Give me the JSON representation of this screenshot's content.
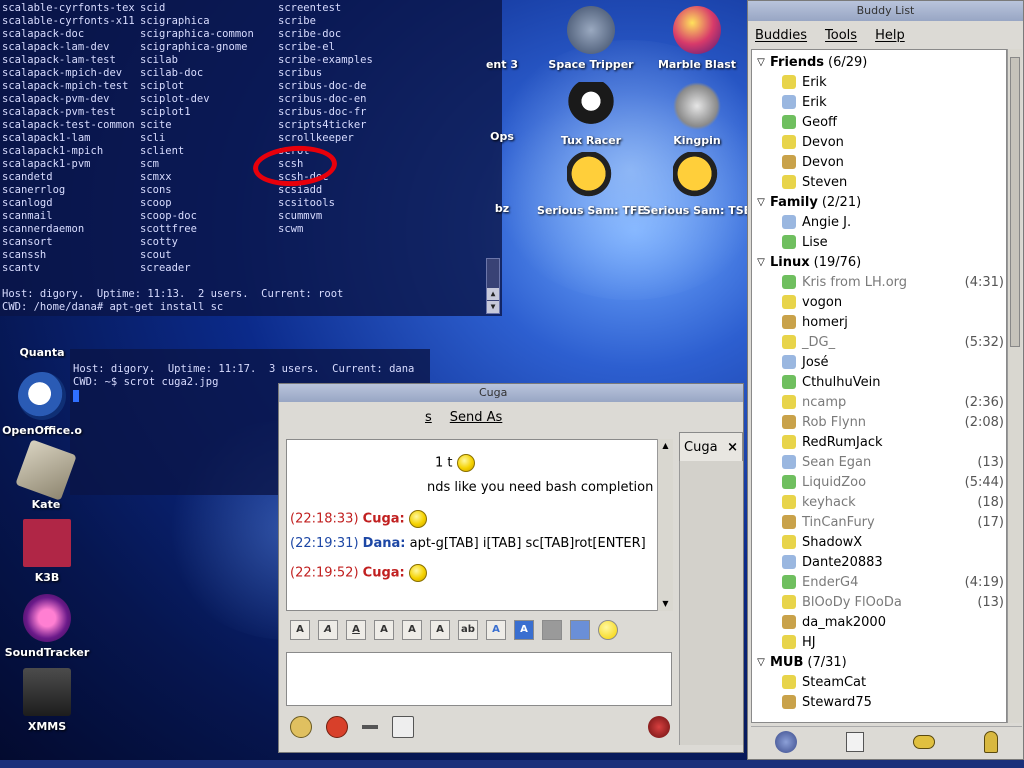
{
  "desktop_icons": [
    {
      "name": "quanta",
      "label": "Quanta"
    },
    {
      "name": "openoffice",
      "label": "OpenOffice.o"
    },
    {
      "name": "kate",
      "label": "Kate"
    },
    {
      "name": "k3b",
      "label": "K3B"
    },
    {
      "name": "soundtracker",
      "label": "SoundTracker"
    },
    {
      "name": "xmms",
      "label": "XMMS"
    },
    {
      "name": "ent3",
      "label": "ent 3"
    },
    {
      "name": "space-tripper",
      "label": "Space Tripper"
    },
    {
      "name": "marble-blast",
      "label": "Marble Blast"
    },
    {
      "name": "ops",
      "label": "Ops"
    },
    {
      "name": "tux-racer",
      "label": "Tux Racer"
    },
    {
      "name": "kingpin",
      "label": "Kingpin"
    },
    {
      "name": "bz",
      "label": "bz"
    },
    {
      "name": "serious-sam-tfe",
      "label": "Serious Sam: TFE"
    },
    {
      "name": "serious-sam-tse",
      "label": "Serious Sam: TSE"
    }
  ],
  "terminal1": {
    "col1": [
      "scalable-cyrfonts-tex",
      "scalable-cyrfonts-x11",
      "scalapack-doc",
      "scalapack-lam-dev",
      "scalapack-lam-test",
      "scalapack-mpich-dev",
      "scalapack-mpich-test",
      "scalapack-pvm-dev",
      "scalapack-pvm-test",
      "scalapack-test-common",
      "scalapack1-lam",
      "scalapack1-mpich",
      "scalapack1-pvm",
      "scandetd",
      "scanerrlog",
      "scanlogd",
      "scanmail",
      "scannerdaemon",
      "scansort",
      "scanssh",
      "scantv"
    ],
    "col2": [
      "scid",
      "scigraphica",
      "scigraphica-common",
      "scigraphica-gnome",
      "scilab",
      "scilab-doc",
      "sciplot",
      "sciplot-dev",
      "sciplot1",
      "scite",
      "scli",
      "sclient",
      "scm",
      "scmxx",
      "scons",
      "scoop",
      "scoop-doc",
      "scottfree",
      "scotty",
      "scout",
      "screader"
    ],
    "col3": [
      "screentest",
      "scribe",
      "scribe-doc",
      "scribe-el",
      "scribe-examples",
      "scribus",
      "scribus-doc-de",
      "scribus-doc-en",
      "scribus-doc-fr",
      "scripts4ticker",
      "scrollkeeper",
      "scrot",
      "scsh",
      "scsh-doc",
      "scsiadd",
      "scsitools",
      "scummvm",
      "scwm",
      "",
      "",
      ""
    ],
    "status": "Host: digory.  Uptime: 11:13.  2 users.  Current: root",
    "prompt": "CWD: /home/dana# apt-get install sc"
  },
  "terminal2": {
    "status": "Host: digory.  Uptime: 11:17.  3 users.  Current: dana",
    "prompt": "CWD: ~$ scrot cuga2.jpg"
  },
  "chat": {
    "title": "Cuga",
    "menu": [
      "s",
      "Send As"
    ],
    "tab_label": "Cuga",
    "tab_close": "×",
    "partial_line_1": "1 t",
    "partial_line_2": "nds like you need bash completion",
    "messages": [
      {
        "time": "(22:18:33)",
        "nick": "Cuga:",
        "text": ""
      },
      {
        "time": "(22:19:31)",
        "nick": "Dana:",
        "text": "apt-g[TAB] i[TAB] sc[TAB]rot[ENTER]"
      },
      {
        "time": "(22:19:52)",
        "nick": "Cuga:",
        "text": ""
      }
    ],
    "format_buttons": [
      "A",
      "A",
      "A",
      "A",
      "A",
      "A",
      "ab",
      "A",
      "A"
    ]
  },
  "buddy_list": {
    "title": "Buddy List",
    "menu": [
      "Buddies",
      "Tools",
      "Help"
    ],
    "groups": [
      {
        "name": "Friends",
        "count": "(6/29)",
        "buddies": [
          {
            "name": "Erik",
            "time": "",
            "idle": false
          },
          {
            "name": "Erik",
            "time": "",
            "idle": false
          },
          {
            "name": "Geoff",
            "time": "",
            "idle": false
          },
          {
            "name": "Devon",
            "time": "",
            "idle": false
          },
          {
            "name": "Devon",
            "time": "",
            "idle": false
          },
          {
            "name": "Steven",
            "time": "",
            "idle": false
          }
        ]
      },
      {
        "name": "Family",
        "count": "(2/21)",
        "buddies": [
          {
            "name": "Angie J.",
            "time": "",
            "idle": false
          },
          {
            "name": "Lise",
            "time": "",
            "idle": false
          }
        ]
      },
      {
        "name": "Linux",
        "count": "(19/76)",
        "buddies": [
          {
            "name": "Kris from LH.org",
            "time": "(4:31)",
            "idle": true
          },
          {
            "name": "vogon",
            "time": "",
            "idle": false
          },
          {
            "name": "homerj",
            "time": "",
            "idle": false
          },
          {
            "name": "_DG_",
            "time": "(5:32)",
            "idle": true
          },
          {
            "name": "José",
            "time": "",
            "idle": false
          },
          {
            "name": "CthulhuVein",
            "time": "",
            "idle": false
          },
          {
            "name": "ncamp",
            "time": "(2:36)",
            "idle": true
          },
          {
            "name": "Rob Flynn",
            "time": "(2:08)",
            "idle": true
          },
          {
            "name": "RedRumJack",
            "time": "",
            "idle": false
          },
          {
            "name": "Sean Egan",
            "time": "(13)",
            "idle": true
          },
          {
            "name": "LiquidZoo",
            "time": "(5:44)",
            "idle": true
          },
          {
            "name": "keyhack",
            "time": "(18)",
            "idle": true
          },
          {
            "name": "TinCanFury",
            "time": "(17)",
            "idle": true
          },
          {
            "name": "ShadowX",
            "time": "",
            "idle": false
          },
          {
            "name": "Dante20883",
            "time": "",
            "idle": false
          },
          {
            "name": "EnderG4",
            "time": "(4:19)",
            "idle": true
          },
          {
            "name": "BlOoDy FlOoDa",
            "time": "(13)",
            "idle": true
          },
          {
            "name": "da_mak2000",
            "time": "",
            "idle": false
          },
          {
            "name": "HJ",
            "time": "",
            "idle": false
          }
        ]
      },
      {
        "name": "MUB",
        "count": "(7/31)",
        "buddies": [
          {
            "name": "SteamCat",
            "time": "",
            "idle": false
          },
          {
            "name": "Steward75",
            "time": "",
            "idle": false
          }
        ]
      }
    ]
  },
  "colors": {
    "accent_red": "#c12020",
    "accent_blue": "#1d47a5",
    "desktop_blue": "#0b2a8a"
  }
}
